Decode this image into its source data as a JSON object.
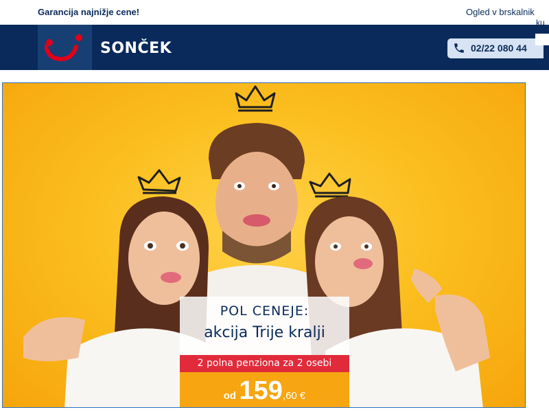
{
  "topbar": {
    "left_text": "Garancija najnižje cene!",
    "right_text": "Ogled v brskalnik",
    "right_text_overflow": "ku"
  },
  "header": {
    "brand": "SONČEK",
    "phone_number": "02/22 080 44",
    "logo_icon": "tui-smile-logo",
    "phone_icon": "phone-icon"
  },
  "hero": {
    "image_desc": "three-people-with-crowns",
    "promo": {
      "line1": "POL CENEJE:",
      "line2": "akcija Trije kralji",
      "offer": "2 polna penziona za 2 osebi",
      "price_prefix": "od",
      "price_main": "159",
      "price_decimal": ",60 €"
    }
  },
  "colors": {
    "navy": "#092a5a",
    "logo_red": "#e2001a",
    "promo_red": "#e12b3b",
    "promo_orange": "#f7a511",
    "phone_bg": "#d7e3f2",
    "hero_yellow": "#fbbf1f"
  }
}
